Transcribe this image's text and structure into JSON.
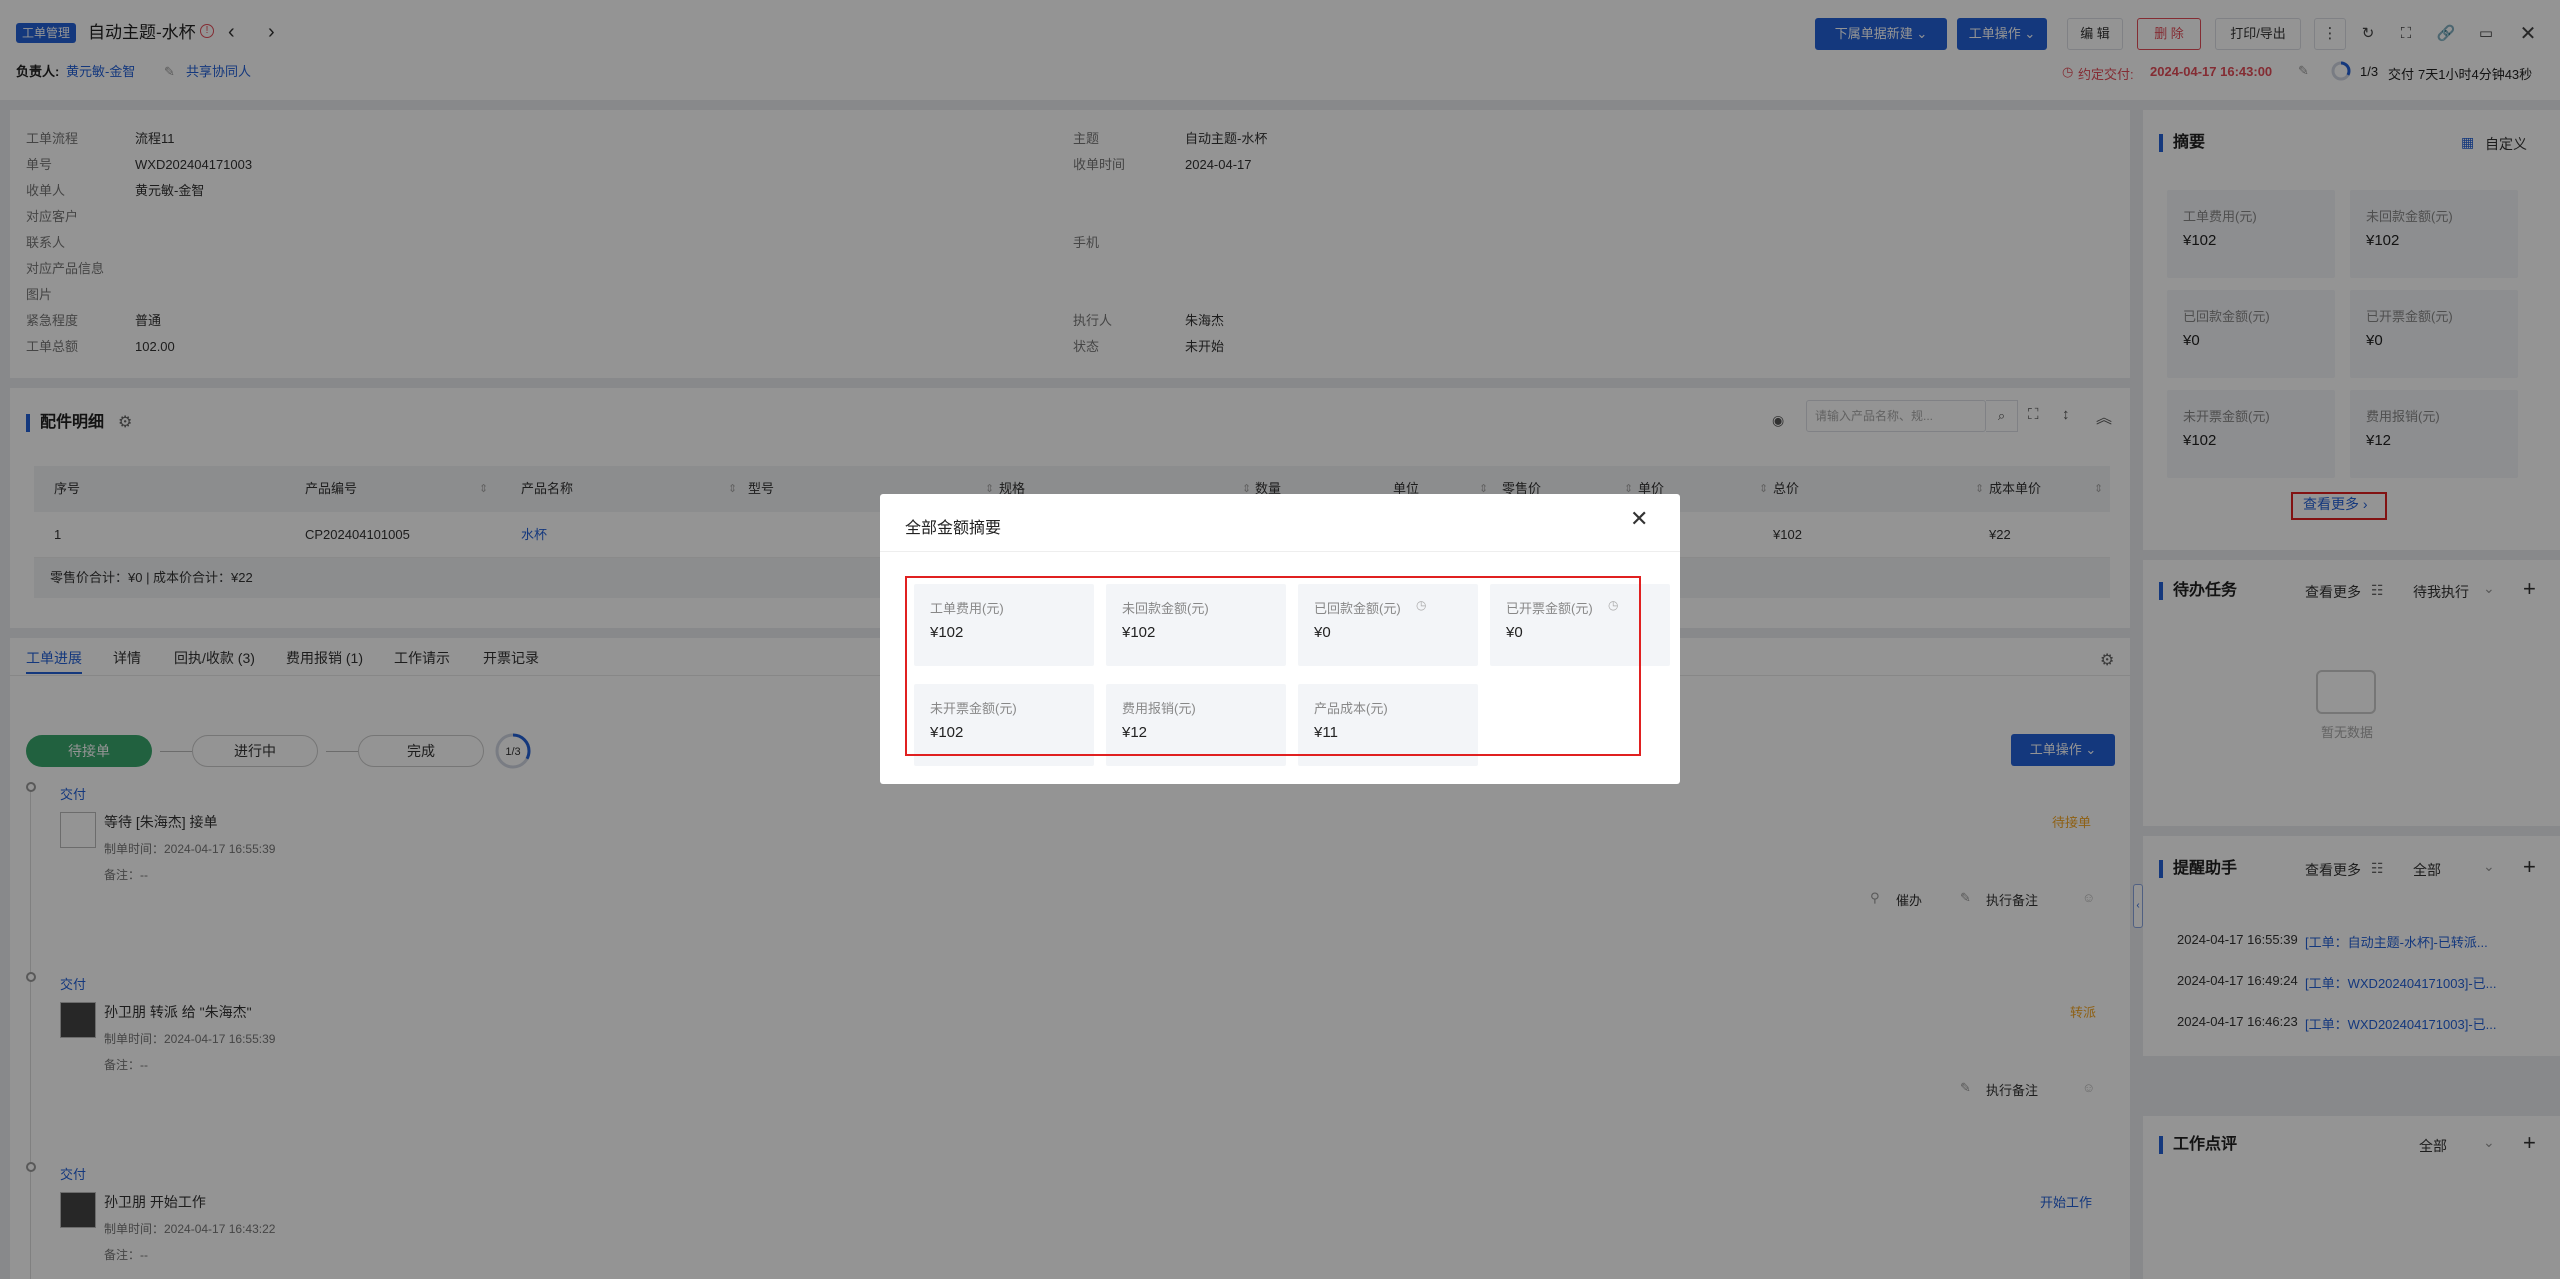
{
  "header": {
    "tag": "工单管理",
    "title": "自动主题-水杯",
    "owner_label": "负责人:",
    "owner_name": "黄元敏-金智",
    "share_label": "共享协同人",
    "buttons": {
      "new_sub": "下属单据新建",
      "ticket_ops": "工单操作",
      "edit": "编 辑",
      "delete": "删 除",
      "print": "打印/导出"
    },
    "deadline_label": "约定交付:",
    "deadline_value": "2024-04-17 16:43:00",
    "progress_text": "1/3",
    "progress_fraction": 0.33,
    "stage_label": "交付",
    "elapsed": "7天1小时4分钟43秒"
  },
  "info": {
    "left": [
      {
        "label": "工单流程",
        "value": "流程11"
      },
      {
        "label": "单号",
        "value": "WXD202404171003"
      },
      {
        "label": "收单人",
        "value": "黄元敏-金智"
      },
      {
        "label": "对应客户",
        "value": ""
      },
      {
        "label": "联系人",
        "value": ""
      },
      {
        "label": "对应产品信息",
        "value": ""
      },
      {
        "label": "图片",
        "value": ""
      },
      {
        "label": "紧急程度",
        "value": "普通"
      },
      {
        "label": "工单总额",
        "value": "102.00"
      }
    ],
    "right": [
      {
        "label": "主题",
        "value": "自动主题-水杯"
      },
      {
        "label": "收单时间",
        "value": "2024-04-17"
      },
      {
        "label": "手机",
        "value": ""
      },
      {
        "label": "执行人",
        "value": "朱海杰"
      },
      {
        "label": "状态",
        "value": "未开始"
      }
    ]
  },
  "parts": {
    "title": "配件明细",
    "search_placeholder": "请输入产品名称、规...",
    "columns": [
      "序号",
      "产品编号",
      "产品名称",
      "型号",
      "规格",
      "数量",
      "单位",
      "零售价",
      "单价",
      "总价",
      "成本单价"
    ],
    "row": {
      "index": "1",
      "code": "CP202404101005",
      "name": "水杯",
      "total": "¥102",
      "cost": "¥22"
    },
    "summary": "零售价合计：¥0 |   成本价合计：¥22"
  },
  "tabs": [
    "工单进展",
    "详情",
    "回执/收款 (3)",
    "费用报销 (1)",
    "工作请示",
    "开票记录"
  ],
  "progress": {
    "steps": [
      "待接单",
      "进行中",
      "完成"
    ],
    "ring_text": "1/3",
    "op_button": "工单操作",
    "entries": [
      {
        "stage": "交付",
        "title": "等待 [朱海杰] 接单",
        "time": "制单时间：2024-04-17 16:55:39",
        "note": "备注：--",
        "status": "待接单",
        "actions": [
          "催办",
          "执行备注"
        ]
      },
      {
        "stage": "交付",
        "title": "孙卫朋 转派 给 \"朱海杰\"",
        "time": "制单时间：2024-04-17 16:55:39",
        "note": "备注：--",
        "status": "转派",
        "actions": [
          "执行备注"
        ]
      },
      {
        "stage": "交付",
        "title": "孙卫朋 开始工作",
        "time": "制单时间：2024-04-17 16:43:22",
        "note": "备注：--",
        "status": "开始工作",
        "actions": []
      }
    ]
  },
  "summary_panel": {
    "title": "摘要",
    "customize": "自定义",
    "metrics": [
      {
        "label": "工单费用(元)",
        "value": "¥102"
      },
      {
        "label": "未回款金额(元)",
        "value": "¥102"
      },
      {
        "label": "已回款金额(元)",
        "value": "¥0"
      },
      {
        "label": "已开票金额(元)",
        "value": "¥0"
      },
      {
        "label": "未开票金额(元)",
        "value": "¥102"
      },
      {
        "label": "费用报销(元)",
        "value": "¥12"
      }
    ],
    "more": "查看更多"
  },
  "todo": {
    "title": "待办任务",
    "more": "查看更多",
    "filter": "待我执行",
    "empty": "暂无数据"
  },
  "reminder": {
    "title": "提醒助手",
    "more": "查看更多",
    "filter": "全部",
    "items": [
      {
        "time": "2024-04-17 16:55:39",
        "text": "[工单：自动主题-水杯]-已转派..."
      },
      {
        "time": "2024-04-17 16:49:24",
        "text": "[工单：WXD202404171003]-已..."
      },
      {
        "time": "2024-04-17 16:46:23",
        "text": "[工单：WXD202404171003]-已..."
      }
    ]
  },
  "review": {
    "title": "工作点评",
    "filter": "全部"
  },
  "modal": {
    "title": "全部金额摘要",
    "metrics": [
      {
        "label": "工单费用(元)",
        "value": "¥102"
      },
      {
        "label": "未回款金额(元)",
        "value": "¥102"
      },
      {
        "label": "已回款金额(元)",
        "value": "¥0"
      },
      {
        "label": "已开票金额(元)",
        "value": "¥0"
      },
      {
        "label": "未开票金额(元)",
        "value": "¥102"
      },
      {
        "label": "费用报销(元)",
        "value": "¥12"
      },
      {
        "label": "产品成本(元)",
        "value": "¥11"
      }
    ]
  }
}
